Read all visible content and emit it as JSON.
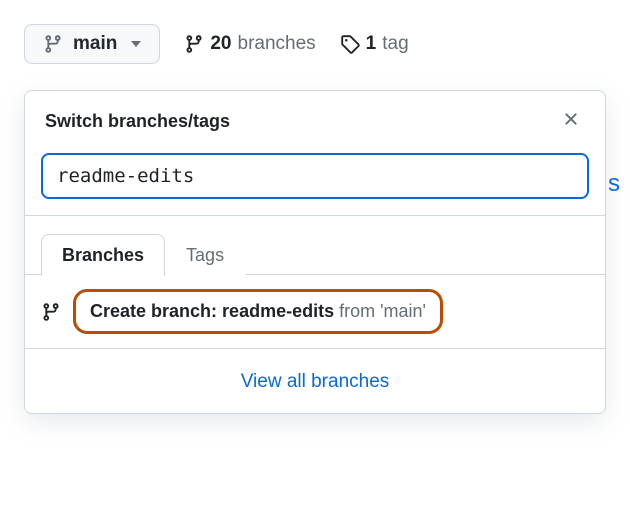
{
  "branchButton": {
    "label": "main"
  },
  "stats": {
    "branches": {
      "count": "20",
      "label": "branches"
    },
    "tags": {
      "count": "1",
      "label": "tag"
    }
  },
  "dropdown": {
    "title": "Switch branches/tags",
    "searchValue": "readme-edits",
    "tabs": {
      "branches": "Branches",
      "tags": "Tags"
    },
    "create": {
      "prefix": "Create branch: ",
      "name": "readme-edits",
      "from": " from 'main'"
    },
    "viewAll": "View all branches"
  }
}
